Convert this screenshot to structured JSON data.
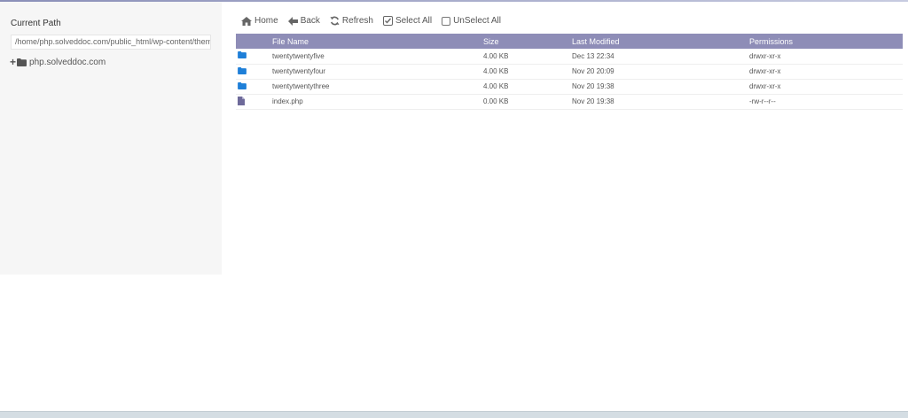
{
  "sidebar": {
    "current_path_label": "Current Path",
    "current_path_value": "/home/php.solveddoc.com/public_html/wp-content/themes",
    "tree_root": "php.solveddoc.com"
  },
  "toolbar": {
    "home": "Home",
    "back": "Back",
    "refresh": "Refresh",
    "select_all": "Select All",
    "unselect_all": "UnSelect All"
  },
  "table": {
    "headers": {
      "name": "File Name",
      "size": "Size",
      "modified": "Last Modified",
      "permissions": "Permissions"
    },
    "rows": [
      {
        "type": "folder",
        "name": "twentytwentyfive",
        "size": "4.00 KB",
        "modified": "Dec 13 22:34",
        "permissions": "drwxr-xr-x"
      },
      {
        "type": "folder",
        "name": "twentytwentyfour",
        "size": "4.00 KB",
        "modified": "Nov 20 20:09",
        "permissions": "drwxr-xr-x"
      },
      {
        "type": "folder",
        "name": "twentytwentythree",
        "size": "4.00 KB",
        "modified": "Nov 20 19:38",
        "permissions": "drwxr-xr-x"
      },
      {
        "type": "file",
        "name": "index.php",
        "size": "0.00 KB",
        "modified": "Nov 20 19:38",
        "permissions": "-rw-r--r--"
      }
    ]
  },
  "colors": {
    "header_bg": "#8e8db7",
    "folder_icon": "#1e7fd8",
    "file_icon": "#6e6a9a",
    "sidebar_bg": "#f6f6f6"
  }
}
